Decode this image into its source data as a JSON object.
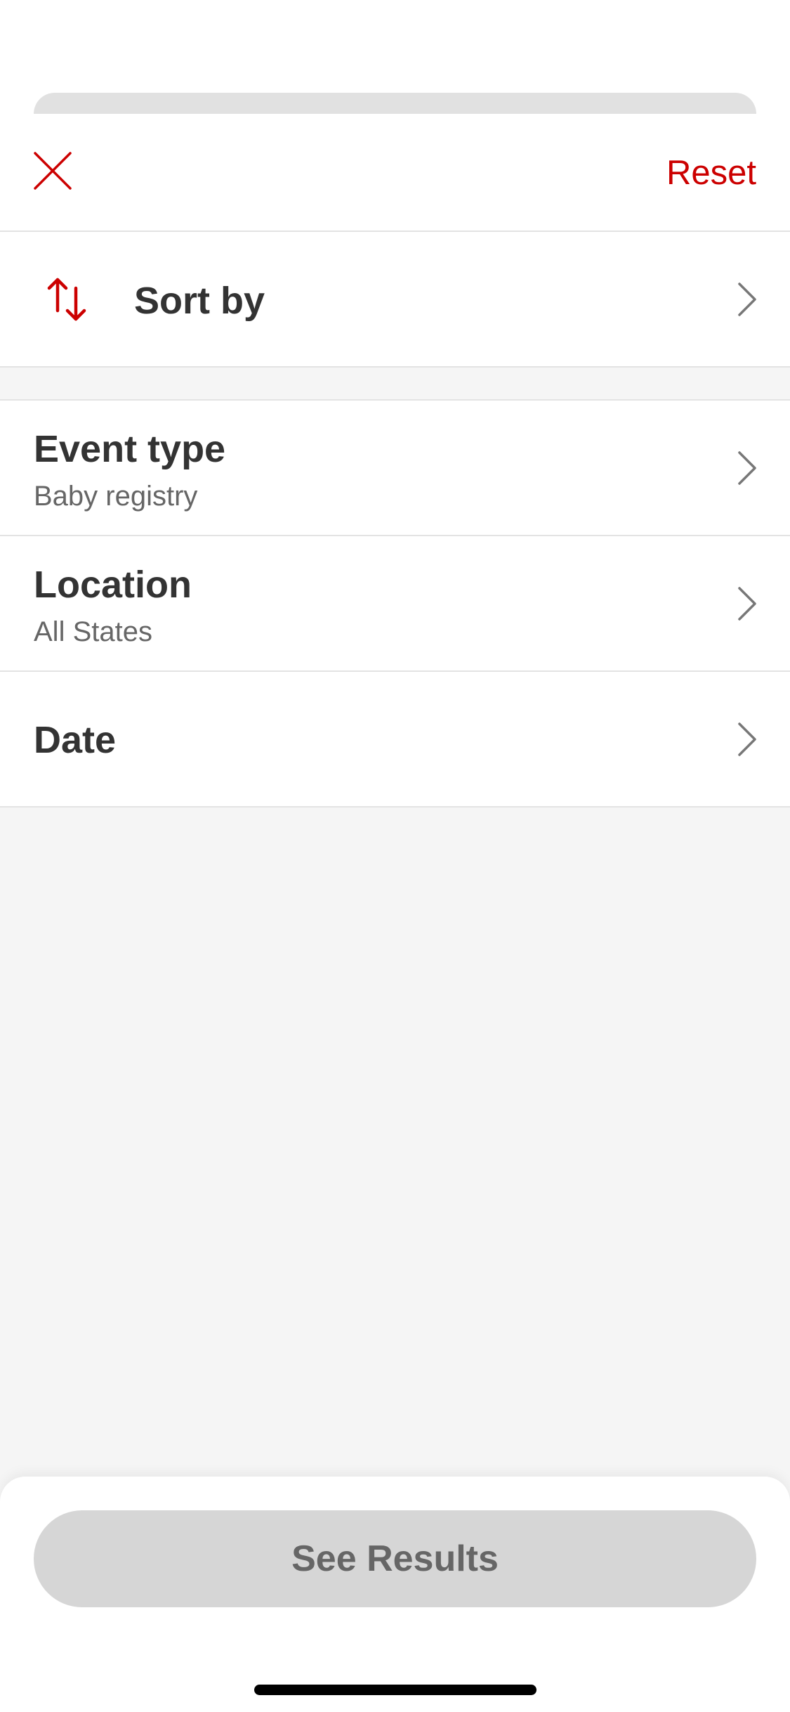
{
  "header": {
    "close_icon": "close-icon",
    "reset_label": "Reset"
  },
  "sort": {
    "icon": "sort-arrows-icon",
    "label": "Sort by"
  },
  "filters": [
    {
      "title": "Event type",
      "value": "Baby registry"
    },
    {
      "title": "Location",
      "value": "All States"
    },
    {
      "title": "Date",
      "value": ""
    }
  ],
  "footer": {
    "button_label": "See Results"
  },
  "colors": {
    "accent": "#cc0000",
    "text_primary": "#333333",
    "text_secondary": "#666666",
    "background": "#f5f5f5",
    "button_disabled": "#d6d6d6"
  }
}
